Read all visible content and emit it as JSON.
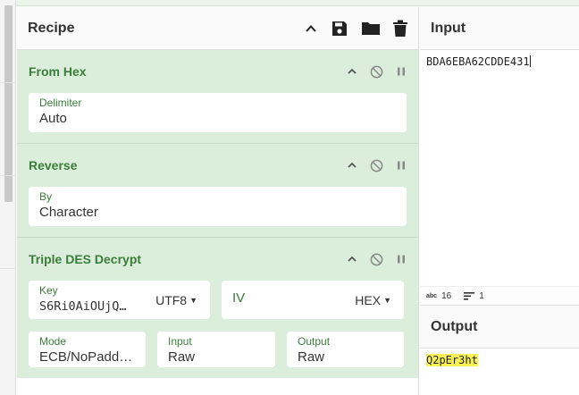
{
  "recipe": {
    "title": "Recipe",
    "icons": [
      "chevron-up-icon",
      "save-icon",
      "folder-icon",
      "trash-icon"
    ]
  },
  "operations": [
    {
      "title": "From Hex",
      "fields": [
        {
          "label": "Delimiter",
          "value": "Auto"
        }
      ]
    },
    {
      "title": "Reverse",
      "fields": [
        {
          "label": "By",
          "value": "Character"
        }
      ]
    },
    {
      "title": "Triple DES Decrypt",
      "key": {
        "label": "Key",
        "value": "S6Ri0AiOUjQ…",
        "encoding": "UTF8"
      },
      "iv": {
        "label": "IV",
        "value": "",
        "encoding": "HEX"
      },
      "mode": {
        "label": "Mode",
        "value": "ECB/NoPaddi…"
      },
      "input": {
        "label": "Input",
        "value": "Raw"
      },
      "output": {
        "label": "Output",
        "value": "Raw"
      }
    }
  ],
  "input": {
    "title": "Input",
    "text": "BDA6EBA62CDDE431",
    "status": {
      "chars_icon": "abc",
      "chars": "16",
      "lines": "1"
    }
  },
  "output": {
    "title": "Output",
    "text": "Q2pEr3ht"
  },
  "colors": {
    "op_bg": "#dbeedb",
    "op_title": "#3a7d3a",
    "output_highlight": "#f8f256"
  }
}
